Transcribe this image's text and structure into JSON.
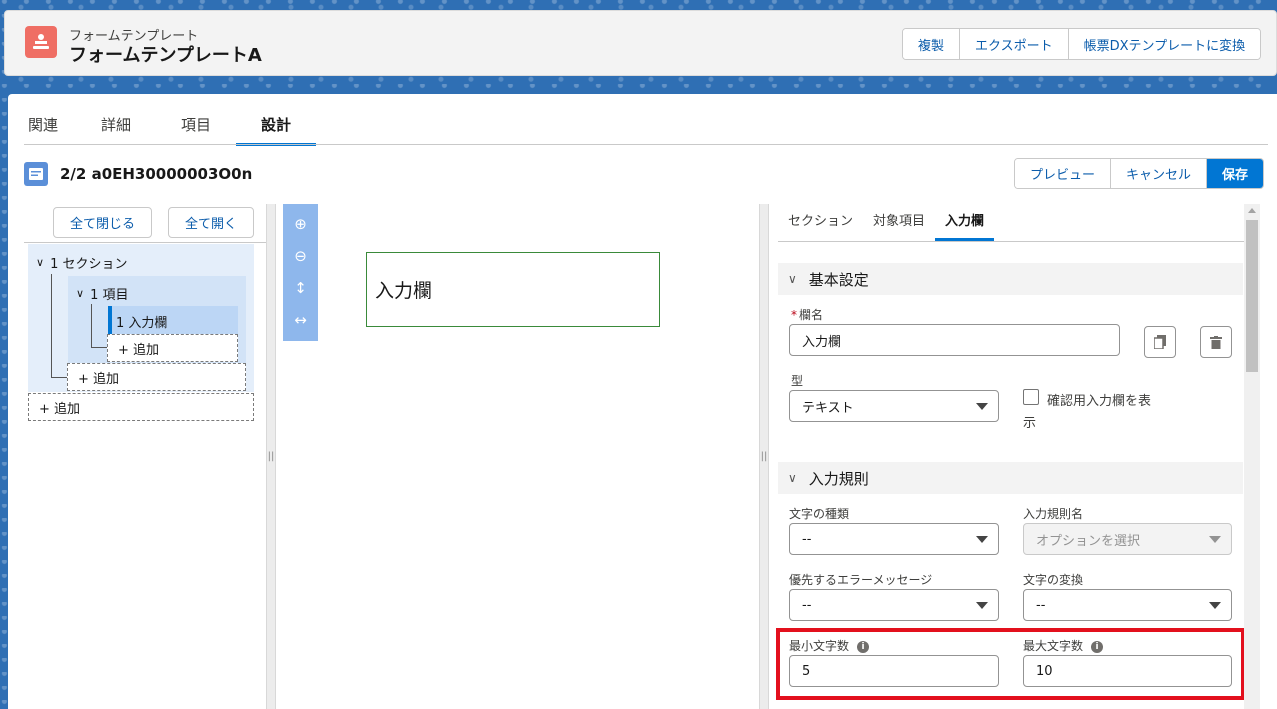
{
  "header": {
    "subtitle": "フォームテンプレート",
    "title": "フォームテンプレートA",
    "actions": [
      "複製",
      "エクスポート",
      "帳票DXテンプレートに変換"
    ]
  },
  "tabs": [
    "関連",
    "詳細",
    "項目",
    "設計"
  ],
  "active_tab": "設計",
  "record": {
    "title": "2/2 a0EH30000003O0n",
    "actions": [
      "プレビュー",
      "キャンセル",
      "保存"
    ]
  },
  "tree": {
    "collapse_all": "全て閉じる",
    "expand_all": "全て開く",
    "section": "1 セクション",
    "item": "1 項目",
    "field": "1 入力欄",
    "add": "+ 追加"
  },
  "preview": {
    "field_label": "入力欄"
  },
  "panel": {
    "tabs": [
      "セクション",
      "対象項目",
      "入力欄"
    ],
    "active_tab": "入力欄",
    "basic_section": "基本設定",
    "name_label": "欄名",
    "name_required_mark": "*",
    "name_value": "入力欄",
    "type_label": "型",
    "type_value": "テキスト",
    "confirm_label_line1": "確認用入力欄を表",
    "confirm_label_line2": "示",
    "confirm_checked": false,
    "rules_section": "入力規則",
    "char_type_label": "文字の種類",
    "char_type_value": "--",
    "rule_name_label": "入力規則名",
    "rule_name_placeholder": "オプションを選択",
    "priority_msg_label": "優先するエラーメッセージ",
    "priority_msg_value": "--",
    "conversion_label": "文字の変換",
    "conversion_value": "--",
    "min_chars_label": "最小文字数",
    "min_chars_value": "5",
    "max_chars_label": "最大文字数",
    "max_chars_value": "10"
  },
  "colors": {
    "brand": "#0176d3",
    "highlight": "#e3101d",
    "header_icon": "#ef6e64"
  }
}
